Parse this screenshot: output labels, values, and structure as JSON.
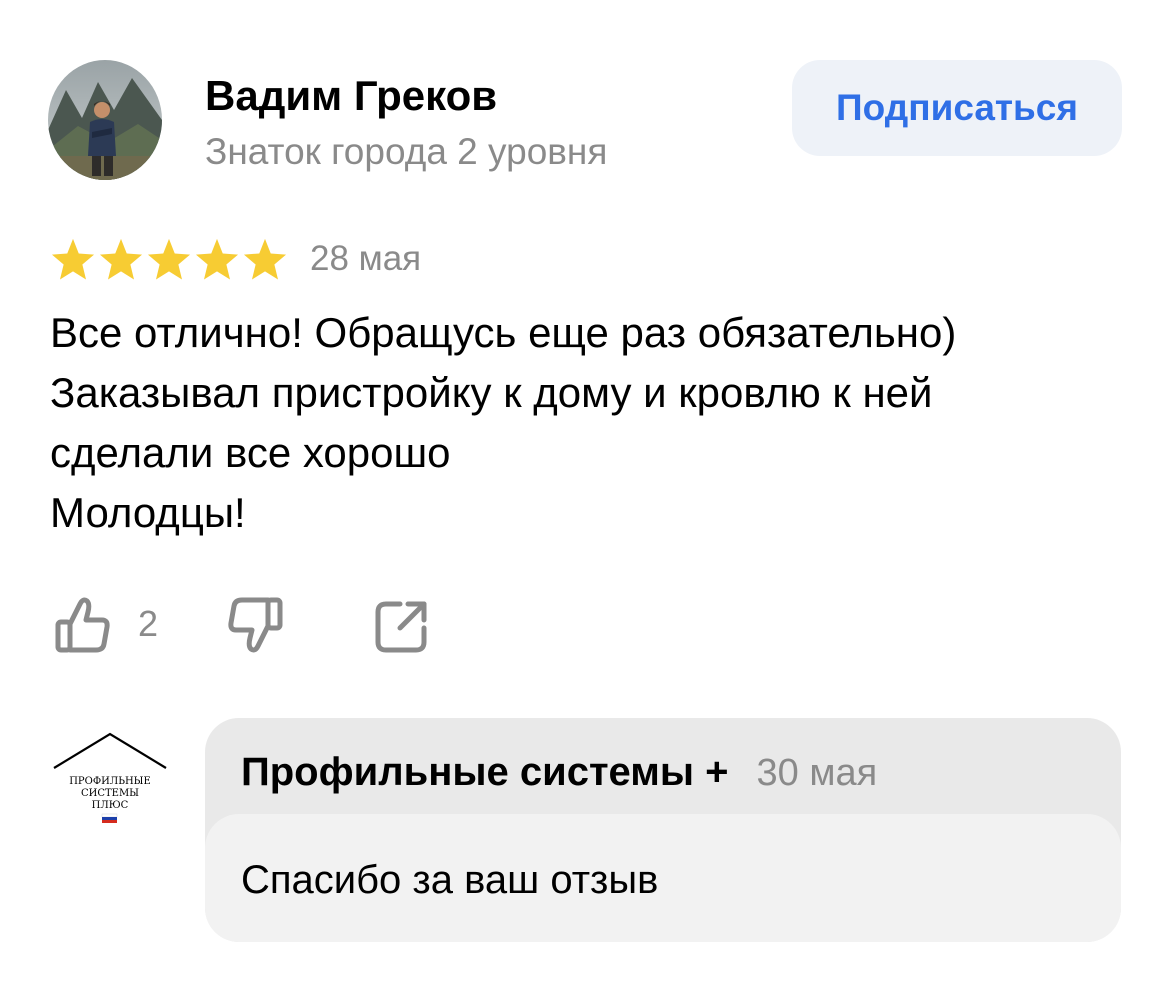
{
  "review": {
    "author": {
      "name": "Вадим Греков",
      "level": "Знаток города 2 уровня",
      "avatar_icon": "user-photo-avatar"
    },
    "subscribe_label": "Подписаться",
    "rating": {
      "stars": 5,
      "max": 5,
      "color": "#f7cc33"
    },
    "date": "28 мая",
    "text_lines": [
      "Все отлично! Обращусь еще раз обязательно)",
      "Заказывал пристройку к дому и кровлю к ней",
      "сделали все хорошо",
      "Молодцы!"
    ],
    "likes": "2",
    "icons": {
      "like": "thumbs-up-icon",
      "dislike": "thumbs-down-icon",
      "share": "share-icon"
    }
  },
  "reply": {
    "company": "Профильные системы +",
    "date": "30 мая",
    "text": "Спасибо за ваш отзыв",
    "logo": {
      "lines": [
        "ПРОФИЛЬНЫЕ",
        "СИСТЕМЫ",
        "ПЛЮС"
      ]
    }
  },
  "colors": {
    "accent": "#2f6fe6",
    "secondary_text": "#8a8a8a",
    "button_bg": "#eef2f8",
    "reply_header_bg": "#e9e9e9",
    "reply_body_bg": "#f2f2f2"
  }
}
